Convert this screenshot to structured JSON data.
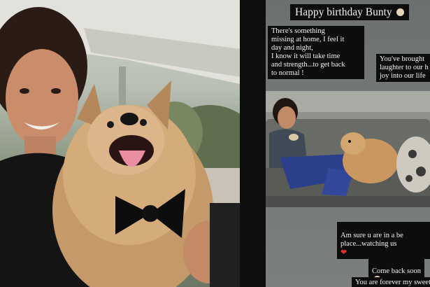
{
  "story": {
    "title": "Happy birthday Bunty",
    "caption_1": "There's something\nmissing at home, I feel it\nday and night,\nI know it will take time\nand strength...to get back\nto normal !",
    "caption_2": "You've brought\nlaughter to our h\njoy into our life",
    "caption_3": "Am sure u are in a be\nplace...watching us",
    "caption_4": "Come back soon",
    "caption_5": "You are forever my sweet",
    "emoji_icon": "dog-face-icon",
    "heart_icon": "heart-icon"
  },
  "colors": {
    "chip_bg": "#0d0d0d",
    "chip_text": "#f4f4f4",
    "story_bg": "#737777",
    "heart": "#e0342f"
  }
}
